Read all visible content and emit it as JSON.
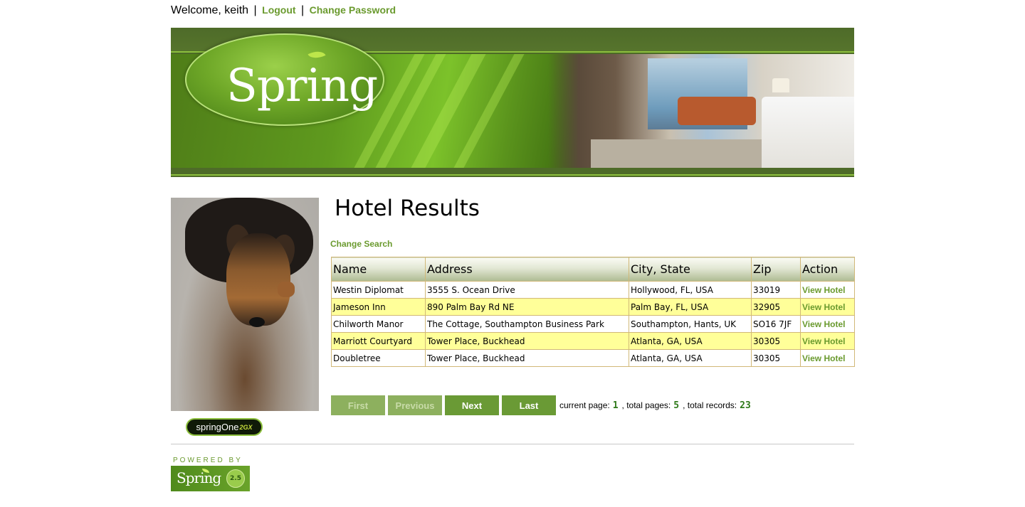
{
  "header": {
    "welcome": "Welcome, keith",
    "separator": "|",
    "logout": "Logout",
    "change_password": "Change Password"
  },
  "banner": {
    "logo_text": "Spring"
  },
  "sidebar": {
    "springone_text": "springOne",
    "springone_year": "2GX"
  },
  "main": {
    "title": "Hotel Results",
    "change_search": "Change Search",
    "columns": [
      "Name",
      "Address",
      "City, State",
      "Zip",
      "Action"
    ],
    "rows": [
      {
        "name": "Westin Diplomat",
        "address": "3555 S. Ocean Drive",
        "city": "Hollywood, FL, USA",
        "zip": "33019",
        "action": "View Hotel"
      },
      {
        "name": "Jameson Inn",
        "address": "890 Palm Bay Rd NE",
        "city": "Palm Bay, FL, USA",
        "zip": "32905",
        "action": "View Hotel"
      },
      {
        "name": "Chilworth Manor",
        "address": "The Cottage, Southampton Business Park",
        "city": "Southampton, Hants, UK",
        "zip": "SO16 7JF",
        "action": "View Hotel"
      },
      {
        "name": "Marriott Courtyard",
        "address": "Tower Place, Buckhead",
        "city": "Atlanta, GA, USA",
        "zip": "30305",
        "action": "View Hotel"
      },
      {
        "name": "Doubletree",
        "address": "Tower Place, Buckhead",
        "city": "Atlanta, GA, USA",
        "zip": "30305",
        "action": "View Hotel"
      }
    ]
  },
  "pager": {
    "first": "First",
    "previous": "Previous",
    "next": "Next",
    "last": "Last",
    "current_page_label": "current page:",
    "current_page": "1",
    "total_pages_label": ", total pages:",
    "total_pages": "5",
    "total_records_label": ", total records:",
    "total_records": "23"
  },
  "footer": {
    "powered_by": "POWERED BY",
    "badge_text": "Spring",
    "badge_version": "2.5"
  },
  "colors": {
    "accent_green": "#6a9a2e",
    "row_highlight": "#ffff99",
    "table_border": "#d1b878"
  }
}
